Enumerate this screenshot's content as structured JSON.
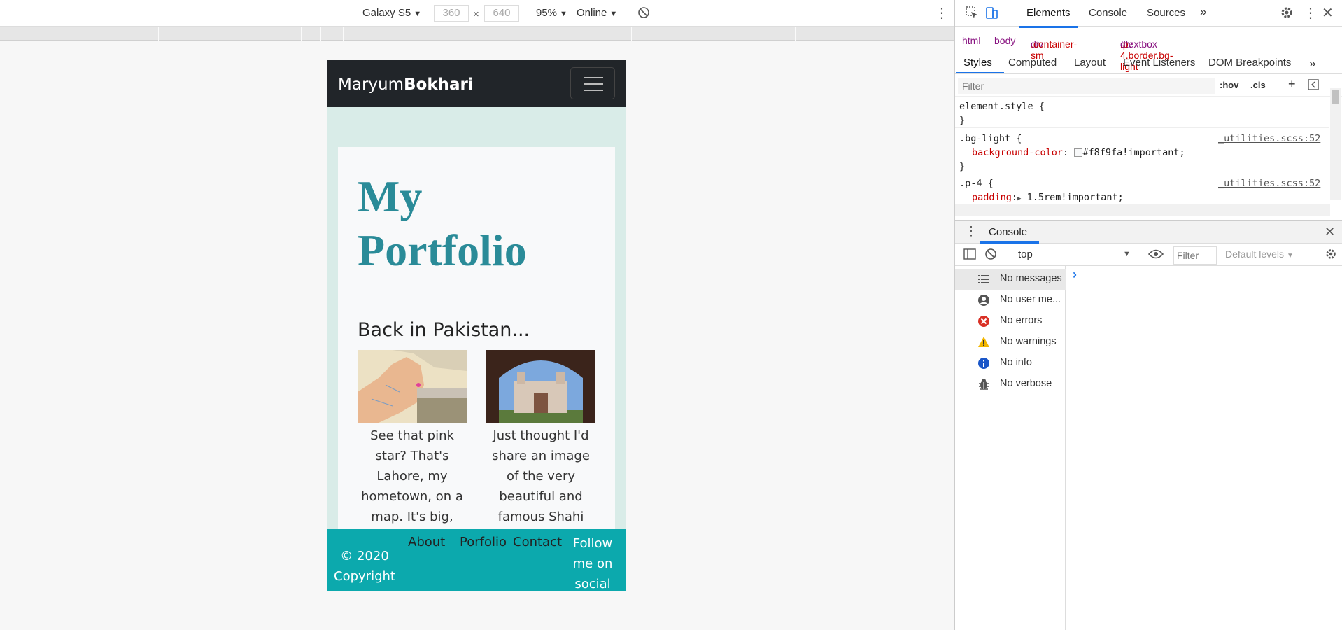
{
  "device_toolbar": {
    "device": "Galaxy S5",
    "width": "360",
    "height": "640",
    "times": "×",
    "zoom": "95%",
    "network": "Online"
  },
  "site": {
    "brand_first": "Maryum",
    "brand_last": "Bokhari",
    "title": "My Portfolio",
    "subtitle": "Back in Pakistan...",
    "caption1": "See that pink star? That's Lahore, my hometown, on a map. It's big, highly advanced",
    "caption2": "Just thought I'd share an image of the very beautiful and famous Shahi Qila, or the Lahore",
    "footer": {
      "copyright": "© 2020 Copyright",
      "about": "About",
      "portfolio": "Porfolio",
      "contact": "Contact",
      "social": "Follow me on social"
    }
  },
  "devtools": {
    "tabs": [
      "Elements",
      "Console",
      "Sources"
    ],
    "more": "»",
    "breadcrumbs": {
      "html": "html",
      "body": "body",
      "div1_tag": "div",
      "div1_class": ".container-sm",
      "div2_tag": "div",
      "div2_id": "#textbox",
      "div2_class": ".p-4.border.bg-light"
    },
    "subtabs": [
      "Styles",
      "Computed",
      "Layout",
      "Event Listeners",
      "DOM Breakpoints"
    ],
    "filter_placeholder": "Filter",
    "hov": ":hov",
    "cls": ".cls",
    "css": {
      "element_style": "element.style {",
      "brace_close": "}",
      "rule1_selector": ".bg-light {",
      "rule1_src": "_utilities.scss:52",
      "rule1_prop": "background-color",
      "rule1_value": "#f8f9fa!important;",
      "rule2_selector": ".p-4 {",
      "rule2_src": "_utilities.scss:52",
      "rule2_prop": "padding",
      "rule2_value": "1.5rem!important;"
    },
    "console_tab": "Console",
    "context": "top",
    "console_filter_placeholder": "Filter",
    "levels": "Default levels",
    "sidebar": [
      {
        "label": "No messages",
        "icon": "list-icon"
      },
      {
        "label": "No user me...",
        "icon": "user-icon"
      },
      {
        "label": "No errors",
        "icon": "error-icon"
      },
      {
        "label": "No warnings",
        "icon": "warning-icon"
      },
      {
        "label": "No info",
        "icon": "info-icon"
      },
      {
        "label": "No verbose",
        "icon": "bug-icon"
      }
    ],
    "prompt": "›",
    "colors": {
      "accent": "#1a73e8",
      "error": "#d93025",
      "warning": "#f2b600",
      "info": "#1a73e8"
    }
  }
}
